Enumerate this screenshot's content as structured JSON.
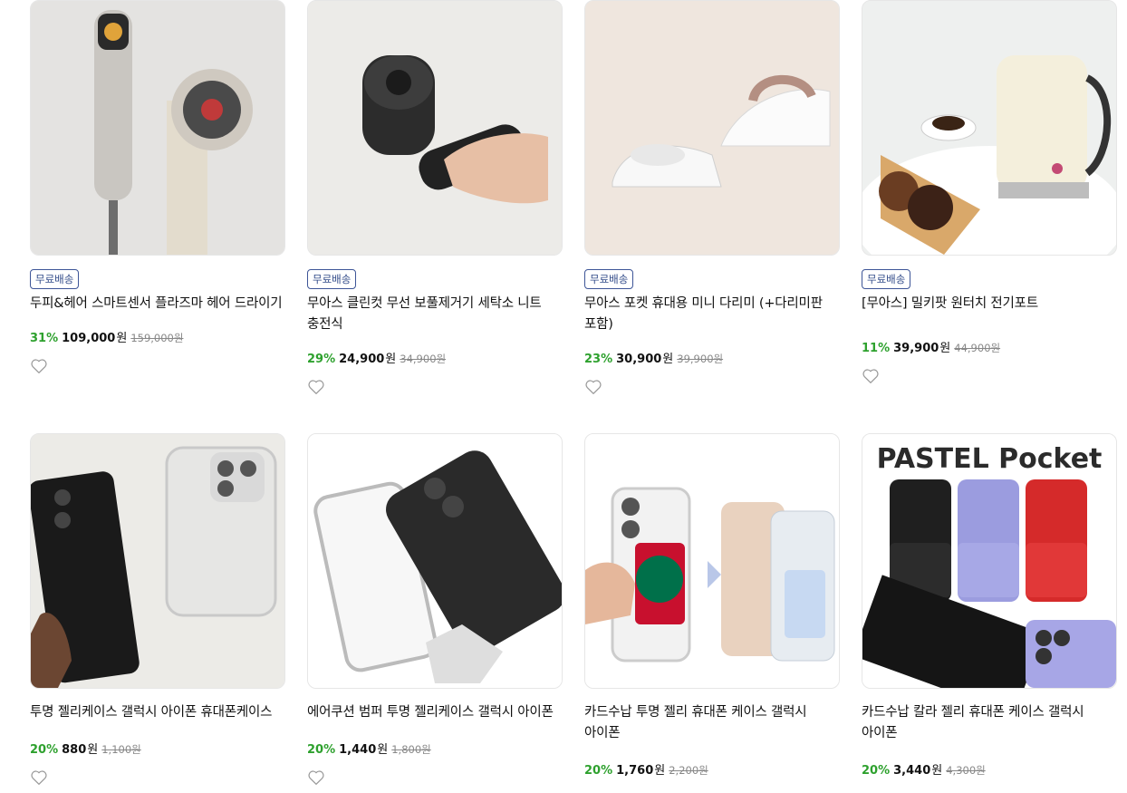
{
  "products": [
    {
      "badge": "무료배송",
      "title": "두피&헤어 스마트센서 플라즈마 헤어 드라이기",
      "discount": "31%",
      "price": "109,000",
      "won": "원",
      "original": "159,000원",
      "image": "hair-dryer-image"
    },
    {
      "badge": "무료배송",
      "title": "무아스 클린컷 무선 보풀제거기 세탁소 니트 충전식",
      "discount": "29%",
      "price": "24,900",
      "won": "원",
      "original": "34,900원",
      "image": "lint-remover-image"
    },
    {
      "badge": "무료배송",
      "title": "무아스 포켓 휴대용 미니 다리미 (+다리미판 포함)",
      "discount": "23%",
      "price": "30,900",
      "won": "원",
      "original": "39,900원",
      "image": "mini-iron-image"
    },
    {
      "badge": "무료배송",
      "title": "[무아스] 밀키팟 원터치 전기포트",
      "discount": "11%",
      "price": "39,900",
      "won": "원",
      "original": "44,900원",
      "image": "electric-kettle-image"
    },
    {
      "badge": "",
      "title": "투명 젤리케이스 갤럭시 아이폰 휴대폰케이스",
      "discount": "20%",
      "price": "880",
      "won": "원",
      "original": "1,100원",
      "image": "clear-phone-case-image"
    },
    {
      "badge": "",
      "title": "에어쿠션 범퍼 투명 젤리케이스 갤럭시 아이폰",
      "discount": "20%",
      "price": "1,440",
      "won": "원",
      "original": "1,800원",
      "image": "bumper-case-image"
    },
    {
      "badge": "",
      "title": "카드수납 투명 젤리 휴대폰 케이스 갤럭시 아이폰",
      "discount": "20%",
      "price": "1,760",
      "won": "원",
      "original": "2,200원",
      "image": "card-case-image"
    },
    {
      "badge": "",
      "title": "카드수납 칼라 젤리 휴대폰 케이스 갤럭시 아이폰",
      "discount": "20%",
      "price": "3,440",
      "won": "원",
      "original": "4,300원",
      "image": "pastel-case-image",
      "image_text": "PASTEL Pocket"
    }
  ],
  "colors": {
    "discount": "#2ea12e",
    "badge_border": "#3d5597",
    "badge_text": "#334c8a"
  }
}
